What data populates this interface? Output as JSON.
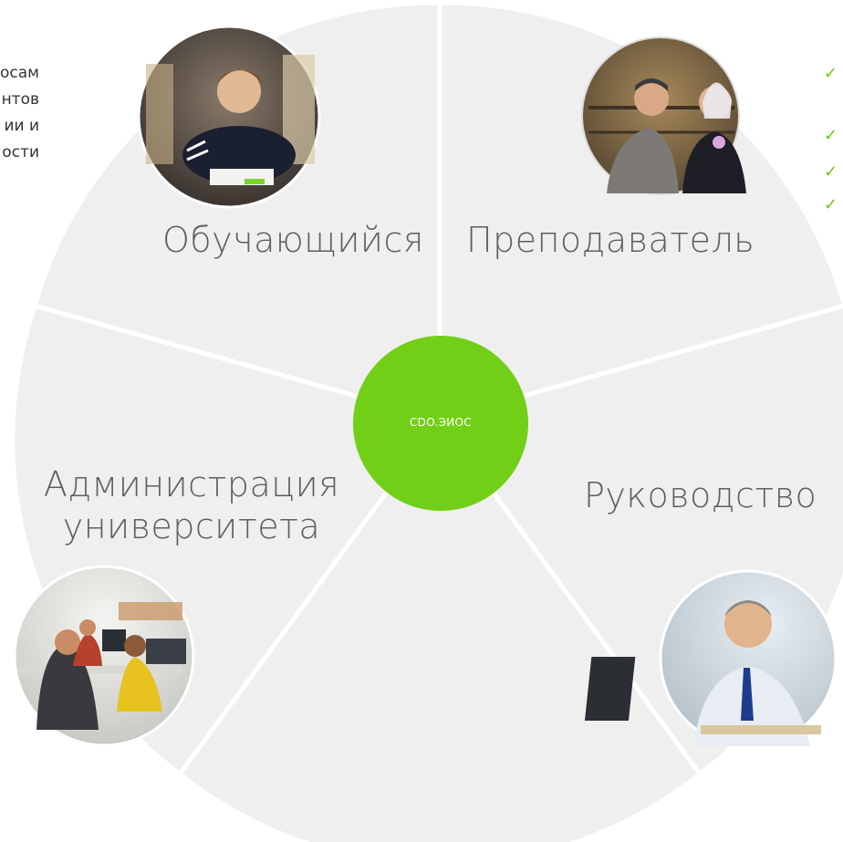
{
  "diagram": {
    "center_label": "СDO.ЭИОС",
    "segments": [
      {
        "id": "student",
        "label": "Обучающийся",
        "photo_icon": "student-studying-photo"
      },
      {
        "id": "teacher",
        "label": "Преподаватель",
        "photo_icon": "teachers-talking-photo"
      },
      {
        "id": "management",
        "label": "Руководство",
        "photo_icon": "thinking-manager-photo"
      },
      {
        "id": "empty",
        "label": ""
      },
      {
        "id": "admin",
        "label": "Администрация университета",
        "photo_icon": "office-workers-photo"
      }
    ]
  },
  "left_fragment": {
    "lines": [
      "осам",
      "нтов",
      "ии и",
      "ости"
    ]
  },
  "right_fragment": {
    "checkmarks": [
      "✓",
      "✓",
      "✓",
      "✓"
    ]
  },
  "colors": {
    "segment_fill": "#efefef",
    "hub_green": "#72cf17",
    "label_text": "#5f5f5f",
    "check_green": "#6cc917"
  }
}
